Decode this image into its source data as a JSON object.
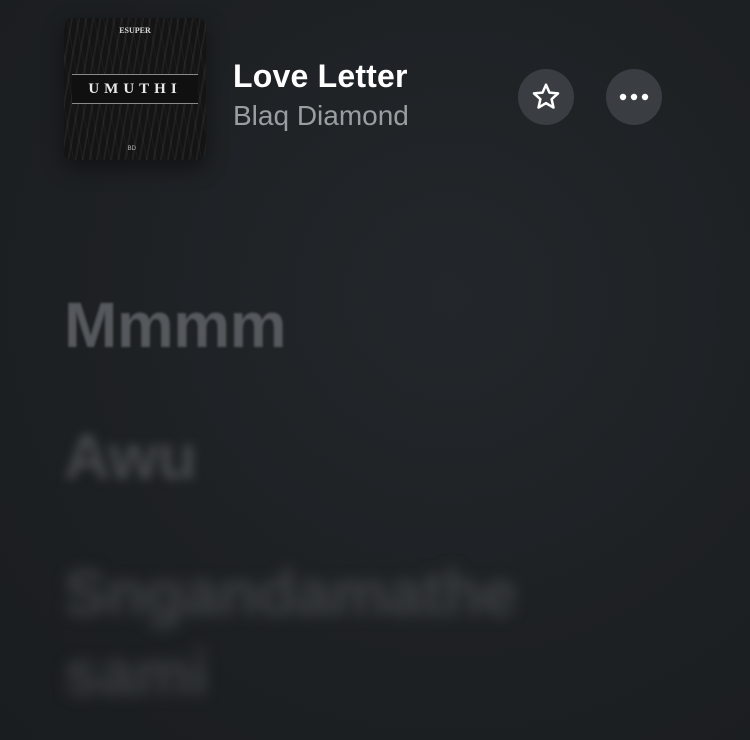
{
  "now_playing": {
    "title": "Love Letter",
    "artist": "Blaq Diamond",
    "album_art": {
      "album_title": "UMUTHI",
      "label_badge": "ESUPER",
      "corner_mark": "BD",
      "colors": {
        "background": "#141414",
        "text": "#e8e8e8"
      }
    }
  },
  "actions": {
    "favorite_icon": "star-icon",
    "more_icon": "ellipsis-icon"
  },
  "lyrics": {
    "lines": [
      "Mmmm",
      "Awu",
      "Sngandamathe",
      "sami"
    ]
  },
  "colors": {
    "background": "#1e2124",
    "button_bg": "#3a3d42",
    "title": "#ffffff",
    "artist": "#9a9ea3"
  }
}
